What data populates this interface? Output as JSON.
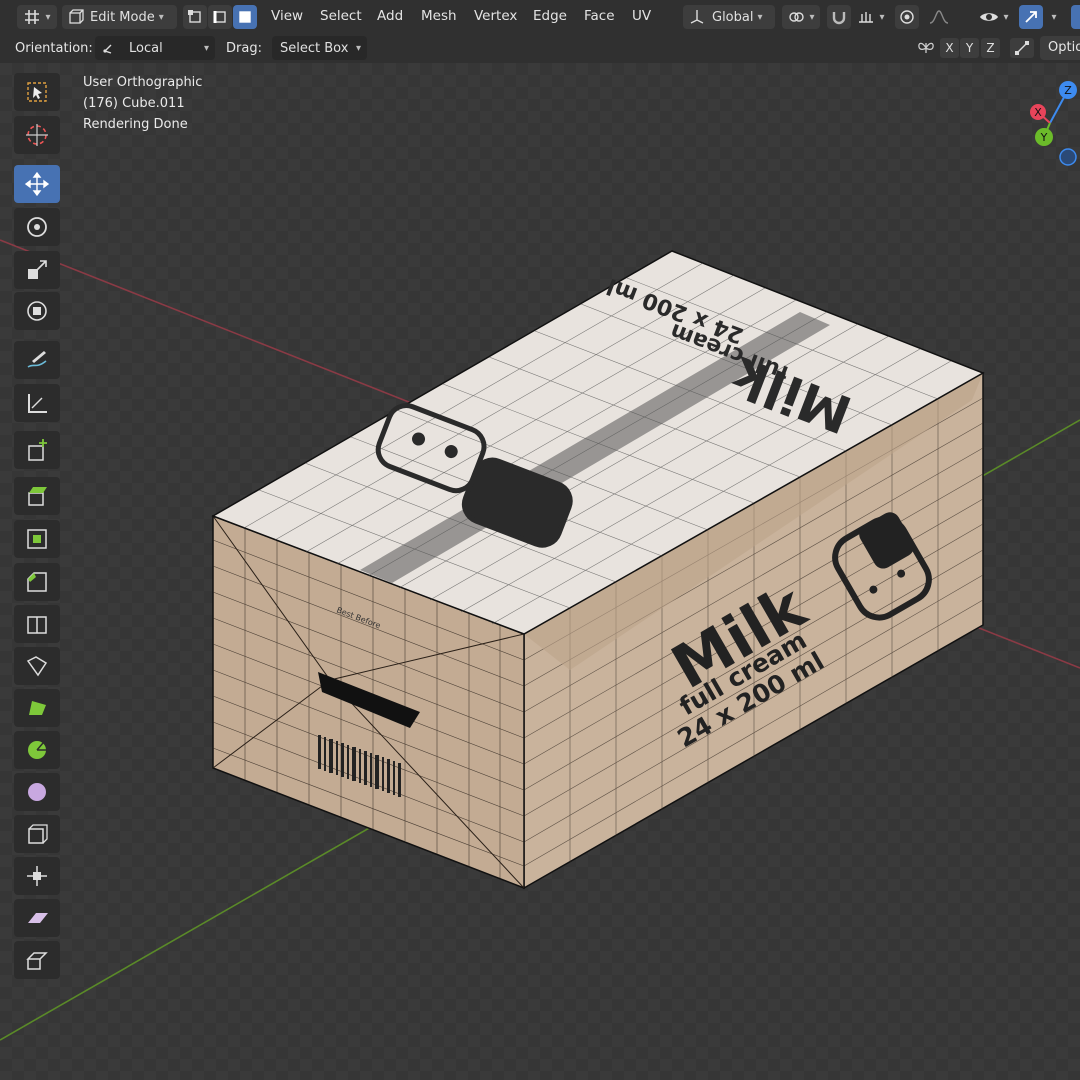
{
  "header": {
    "mode_label": "Edit Mode",
    "menus": [
      "View",
      "Select",
      "Add",
      "Mesh",
      "Vertex",
      "Edge",
      "Face",
      "UV"
    ],
    "transform_orientation": "Global"
  },
  "tool_options": {
    "orientation_label": "Orientation:",
    "orientation_value": "Local",
    "drag_label": "Drag:",
    "drag_value": "Select Box",
    "axes": [
      "X",
      "Y",
      "Z"
    ],
    "options_label": "Optio"
  },
  "viewport": {
    "view_name": "User Orthographic",
    "object_info": "(176) Cube.011",
    "status": "Rendering Done"
  },
  "gizmo": {
    "z": "Z",
    "x": "X",
    "y": "Y"
  },
  "model_text": {
    "top_brand": "Milk",
    "top_sub": "full cream",
    "top_size": "24 x 200 ml",
    "side_brand": "Milk",
    "side_sub": "full cream",
    "side_size": "24 x 200 ml",
    "best_before": "Best Before"
  },
  "colors": {
    "accent": "#4772b3",
    "axis_x": "#e8445a",
    "axis_y": "#6bbb2a",
    "axis_z": "#3d8bf0",
    "box_side": "#c7b19b",
    "box_top": "#e8e3de"
  },
  "toolbar_icons": [
    "select-box-icon",
    "cursor-icon",
    "move-icon",
    "rotate-icon",
    "scale-icon",
    "transform-icon",
    "annotate-icon",
    "measure-icon",
    "add-cube-icon",
    "extrude-icon",
    "inset-icon",
    "bevel-icon",
    "loop-cut-icon",
    "knife-icon",
    "poly-build-icon",
    "spin-icon",
    "smooth-icon",
    "edge-slide-icon",
    "shrink-fatten-icon",
    "shear-icon",
    "rip-icon"
  ]
}
